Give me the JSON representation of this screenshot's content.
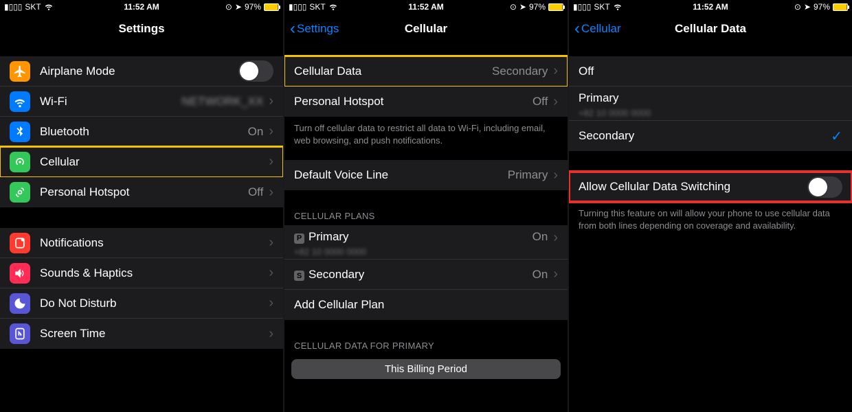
{
  "status": {
    "carrier": "SKT",
    "time": "11:52 AM",
    "battery": "97%"
  },
  "p1": {
    "title": "Settings",
    "rows": {
      "airplane": "Airplane Mode",
      "wifi": "Wi-Fi",
      "wifi_val": "",
      "bt": "Bluetooth",
      "bt_val": "On",
      "cell": "Cellular",
      "hotspot": "Personal Hotspot",
      "hotspot_val": "Off",
      "notif": "Notifications",
      "sounds": "Sounds & Haptics",
      "dnd": "Do Not Disturb",
      "screentime": "Screen Time"
    }
  },
  "p2": {
    "back": "Settings",
    "title": "Cellular",
    "cell_data": "Cellular Data",
    "cell_data_val": "Secondary",
    "hotspot": "Personal Hotspot",
    "hotspot_val": "Off",
    "note": "Turn off cellular data to restrict all data to Wi-Fi, including email, web browsing, and push notifications.",
    "default_voice": "Default Voice Line",
    "default_voice_val": "Primary",
    "plans_header": "CELLULAR PLANS",
    "primary": "Primary",
    "primary_val": "On",
    "secondary": "Secondary",
    "secondary_val": "On",
    "add_plan": "Add Cellular Plan",
    "data_header": "CELLULAR DATA FOR PRIMARY",
    "billing": "This Billing Period"
  },
  "p3": {
    "back": "Cellular",
    "title": "Cellular Data",
    "off": "Off",
    "primary": "Primary",
    "secondary": "Secondary",
    "switch": "Allow Cellular Data Switching",
    "note": "Turning this feature on will allow your phone to use cellular data from both lines depending on coverage and availability."
  }
}
